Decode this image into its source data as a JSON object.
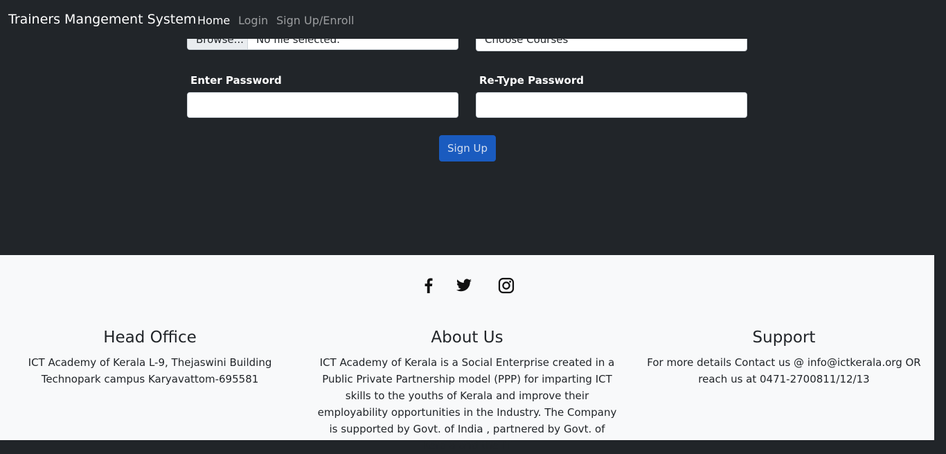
{
  "navbar": {
    "brand": "Trainers Mangement System",
    "links": [
      {
        "label": "Home",
        "active": true
      },
      {
        "label": "Login",
        "active": false
      },
      {
        "label": "Sign Up/Enroll",
        "active": false
      }
    ]
  },
  "form": {
    "file_button": "Browse...",
    "file_status": "No file selected.",
    "courses_select": "Choose Courses",
    "password_label": "Enter Password",
    "password_value": "",
    "retype_label": "Re-Type Password",
    "retype_value": "",
    "submit_label": "Sign Up"
  },
  "footer": {
    "social_icons": [
      "facebook-icon",
      "twitter-icon",
      "instagram-icon"
    ],
    "head_office": {
      "title": "Head Office",
      "text": "ICT Academy of Kerala L-9, Thejaswini Building Technopark campus Karyavattom-695581"
    },
    "about": {
      "title": "About Us",
      "text": "ICT Academy of Kerala is a Social Enterprise created in a Public Private Partnership model (PPP) for imparting ICT skills to the youths of Kerala and improve their employability opportunities in the Industry. The Company is supported by Govt. of India , partnered by Govt. of Kerala and the IT"
    },
    "support": {
      "title": "Support",
      "text": "For more details Contact us @ info@ictkerala.org OR reach us at 0471-2700811/12/13"
    }
  },
  "colors": {
    "page_background": "#212529",
    "footer_background": "#f8f9fa",
    "primary_button": "#1a5bbf"
  }
}
